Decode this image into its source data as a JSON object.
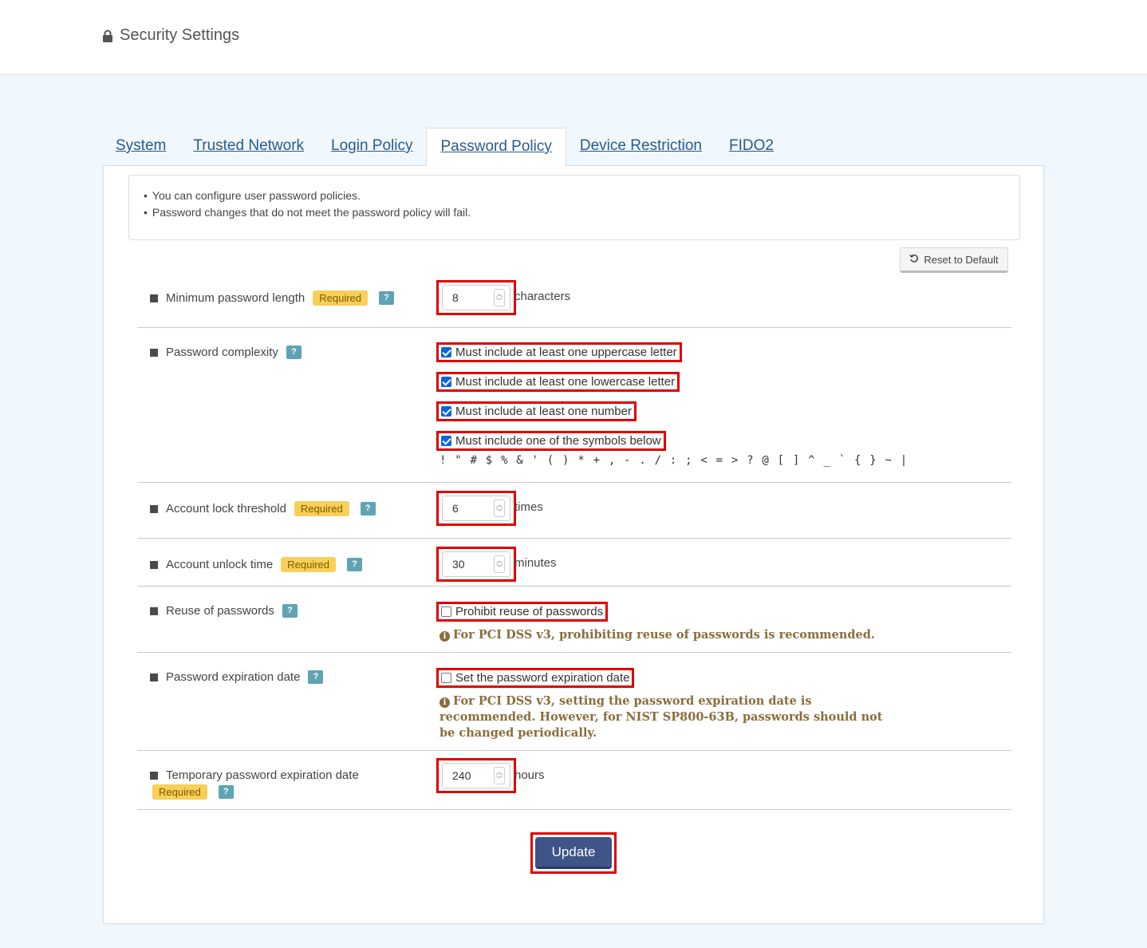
{
  "header": {
    "title": "Security Settings"
  },
  "tabs": [
    {
      "label": "System"
    },
    {
      "label": "Trusted Network"
    },
    {
      "label": "Login Policy"
    },
    {
      "label": "Password Policy"
    },
    {
      "label": "Device Restriction"
    },
    {
      "label": "FIDO2"
    }
  ],
  "notice": [
    "You can configure user password policies.",
    "Password changes that do not meet the password policy will fail."
  ],
  "reset_label": "Reset to Default",
  "required_label": "Required",
  "help_label": "?",
  "fields": {
    "min_length": {
      "label": "Minimum password length",
      "value": "8",
      "unit": "characters"
    },
    "complexity": {
      "label": "Password complexity",
      "options": [
        {
          "label": "Must include at least one uppercase letter",
          "checked": true
        },
        {
          "label": "Must include at least one lowercase letter",
          "checked": true
        },
        {
          "label": "Must include at least one number",
          "checked": true
        },
        {
          "label": "Must include one of the symbols below",
          "checked": true
        }
      ],
      "symbols": "! \" # $ % & ' ( ) * + , - . / : ; < = > ? @ [ ] ^ _ ` { } ~ |"
    },
    "lock_threshold": {
      "label": "Account lock threshold",
      "value": "6",
      "unit": "times"
    },
    "unlock_time": {
      "label": "Account unlock time",
      "value": "30",
      "unit": "minutes"
    },
    "reuse": {
      "label": "Reuse of passwords",
      "option": "Prohibit reuse of passwords",
      "checked": false,
      "info": "For PCI DSS v3, prohibiting reuse of passwords is recommended."
    },
    "expiration": {
      "label": "Password expiration date",
      "option": "Set the password expiration date",
      "checked": false,
      "info_lines": [
        "For PCI DSS v3, setting the password expiration date is",
        "recommended. However, for NIST SP800-63B, passwords should not",
        "be changed periodically."
      ]
    },
    "temp_expiration": {
      "label": "Temporary password expiration date",
      "value": "240",
      "unit": "hours"
    }
  },
  "update_label": "Update"
}
